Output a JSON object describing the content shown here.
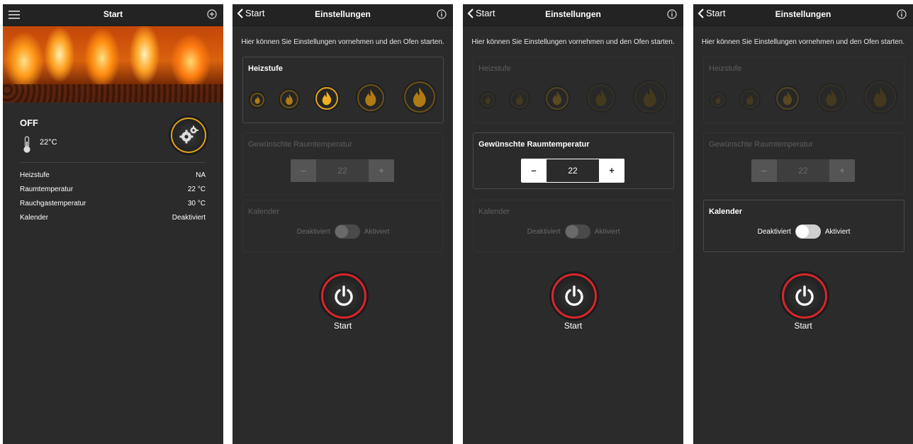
{
  "home": {
    "title": "Start",
    "status": "OFF",
    "current_temp": "22°C",
    "rows": [
      {
        "label": "Heizstufe",
        "value": "NA"
      },
      {
        "label": "Raumtemperatur",
        "value": "22 °C"
      },
      {
        "label": "Rauchgastemperatur",
        "value": "30 °C"
      },
      {
        "label": "Kalender",
        "value": "Deaktiviert"
      }
    ]
  },
  "settings": {
    "back_label": "Start",
    "title": "Einstellungen",
    "hint": "Hier können Sie Einstellungen vornehmen und den Ofen starten.",
    "heat_label": "Heizstufe",
    "temp_label": "Gewünschte Raumtemperatur",
    "temp_value": "22",
    "minus": "–",
    "plus": "+",
    "calendar_label": "Kalender",
    "toggle_off_label": "Deaktiviert",
    "toggle_on_label": "Aktiviert",
    "start_label": "Start"
  },
  "colors": {
    "accent": "#e0a21c",
    "power": "#d9252a",
    "bg": "#2b2b2b"
  }
}
